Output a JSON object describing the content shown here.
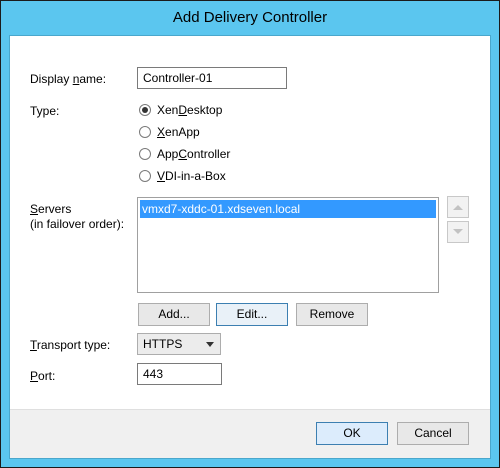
{
  "window": {
    "title": "Add Delivery Controller"
  },
  "form": {
    "display_name_label_pre": "Display ",
    "display_name_label_u": "n",
    "display_name_label_post": "ame:",
    "display_name_value": "Controller-01",
    "type_label": "Type:",
    "types": [
      {
        "pre": "Xen",
        "u": "D",
        "post": "esktop",
        "selected": true
      },
      {
        "pre": "",
        "u": "X",
        "post": "enApp",
        "selected": false
      },
      {
        "pre": "App",
        "u": "C",
        "post": "ontroller",
        "selected": false
      },
      {
        "pre": "",
        "u": "V",
        "post": "DI-in-a-Box",
        "selected": false
      }
    ],
    "servers_label_u": "S",
    "servers_label_post": "ervers",
    "servers_sublabel": "(in failover order):",
    "servers": [
      "vmxd7-xddc-01.xdseven.local"
    ],
    "add_button": "Add...",
    "edit_button": "Edit...",
    "remove_button": "Remove",
    "transport_label_u": "T",
    "transport_label_post": "ransport type:",
    "transport_value": "HTTPS",
    "port_label_u": "P",
    "port_label_post": "ort:",
    "port_value": "443"
  },
  "footer": {
    "ok_button": "OK",
    "cancel_button": "Cancel"
  }
}
